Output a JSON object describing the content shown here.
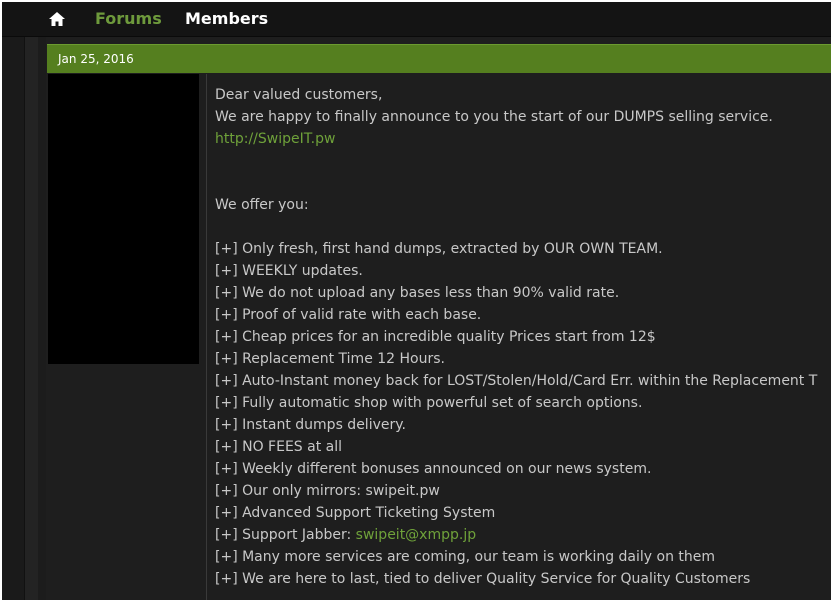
{
  "nav": {
    "home_icon": "home-icon",
    "forums_label": "Forums",
    "members_label": "Members"
  },
  "post": {
    "date": "Jan 25, 2016",
    "greeting": "Dear valued customers,",
    "intro": "We are happy to finally announce to you the start of our DUMPS selling service.",
    "site_link": "http://SwipeIT.pw",
    "offer_heading": "We offer you:",
    "bullets": [
      "[+] Only fresh, first hand dumps, extracted by OUR OWN TEAM.",
      "[+] WEEKLY updates.",
      "[+] We do not upload any bases less than 90% valid rate.",
      "[+] Proof of valid rate with each base.",
      "[+] Cheap prices for an incredible quality Prices start from 12$",
      "[+] Replacement Time 12 Hours.",
      "[+] Auto-Instant money back for LOST/Stolen/Hold/Card Err. within the Replacement T",
      "[+] Fully automatic shop with powerful set of search options.",
      "[+] Instant dumps delivery.",
      "[+] NO FEES at all",
      "[+] Weekly different bonuses announced on our news system.",
      "[+] Our only mirrors: swipeit.pw",
      "[+] Advanced Support Ticketing System"
    ],
    "jabber_prefix": "[+] Support Jabber: ",
    "jabber_link": "swipeit@xmpp.jp",
    "bullets_tail": [
      "[+] Many more services are coming, our team is working daily on them",
      "[+] We are here to last, tied to deliver Quality Service for Quality Customers"
    ]
  },
  "colors": {
    "accent_green": "#557f1f",
    "link_green": "#6fa23a",
    "background": "#1e1e1e"
  }
}
